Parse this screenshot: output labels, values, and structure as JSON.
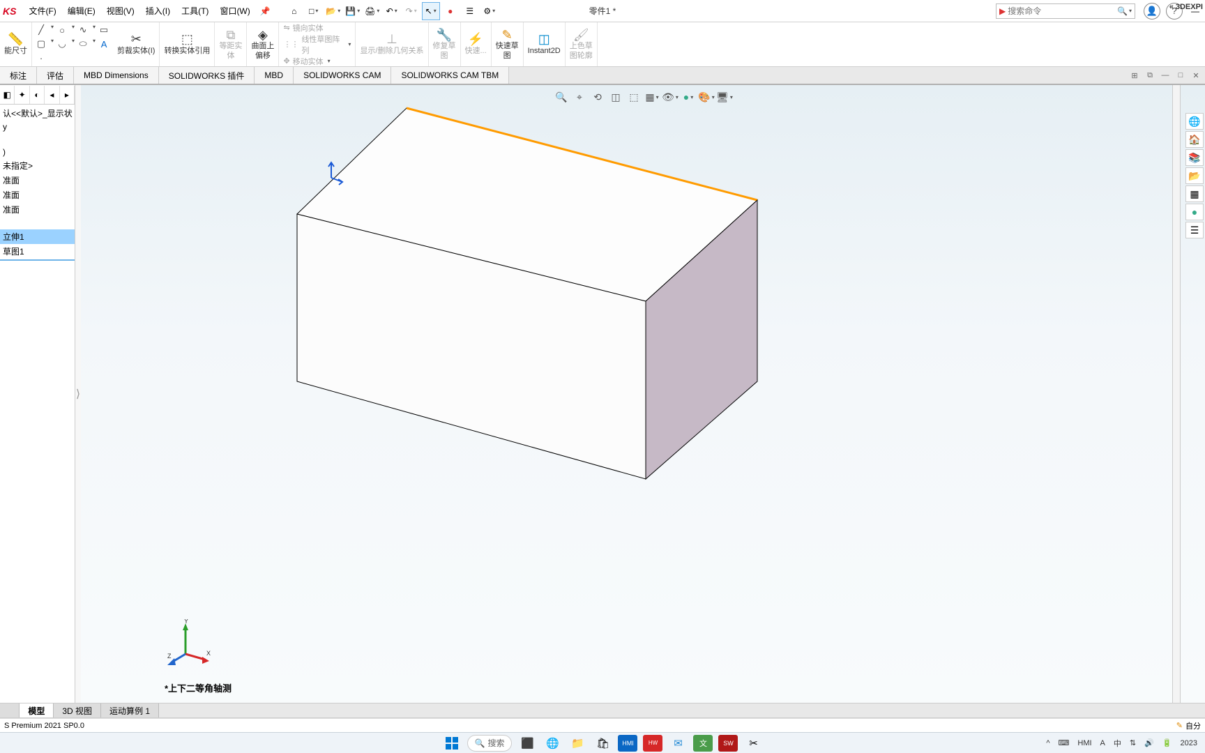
{
  "app_logo_text": "KS",
  "menu": {
    "file": "文件(F)",
    "edit": "编辑(E)",
    "view": "视图(V)",
    "insert": "插入(I)",
    "tools": "工具(T)",
    "window": "窗口(W)"
  },
  "doc_title": "零件1 *",
  "search_placeholder": "搜索命令",
  "ribbon": {
    "smart_dim": "能尺寸",
    "trim": "剪裁实体(I)",
    "convert": "转换实体引用",
    "offset": "等距实\n体",
    "surface_offset": "曲面上\n偏移",
    "mirror": "镜向实体",
    "linear_pattern": "线性草图阵列",
    "move": "移动实体",
    "relations": "显示/删除几何关系",
    "repair": "修复草\n图",
    "quick": "快速...",
    "quick_sketch": "快速草\n图",
    "instant2d": "Instant2D",
    "color_sketch": "上色草\n图轮廓"
  },
  "tabs": [
    "标注",
    "评估",
    "MBD Dimensions",
    "SOLIDWORKS 插件",
    "MBD",
    "SOLIDWORKS CAM",
    "SOLIDWORKS CAM TBM"
  ],
  "tree": {
    "config": "认<<默认>_显示状",
    "history": "y",
    "material": "未指定>",
    "plane1": "准面",
    "plane2": "准面",
    "plane3": "准面",
    "feature": "立伸1",
    "sketch": "草图1"
  },
  "view_label": "*上下二等角轴测",
  "bottom_tabs": [
    "模型",
    "3D 视图",
    "运动算例 1"
  ],
  "status_text": "S Premium 2021 SP0.0",
  "status_right": "自分",
  "side_panel": "« 3DEXPI",
  "taskbar_search": "搜索",
  "taskbar_right": {
    "ime": "中",
    "year": "2023"
  },
  "icons": {
    "home": "⌂",
    "new": "□",
    "open": "📂",
    "save": "💾",
    "print": "🖨",
    "undo": "↶",
    "redo": "↷",
    "select": "↖",
    "options": "⚙",
    "list": "☰",
    "rebuild": "●",
    "user": "👤",
    "help": "?",
    "min": "—",
    "search": "🔍",
    "dd": "▾",
    "fit": "🔎",
    "prev": "⟲",
    "sec": "▦",
    "style": "◫",
    "scene": "🏞",
    "hide": "👁",
    "appear": "🎨",
    "render": "🎥",
    "play": "▭"
  }
}
